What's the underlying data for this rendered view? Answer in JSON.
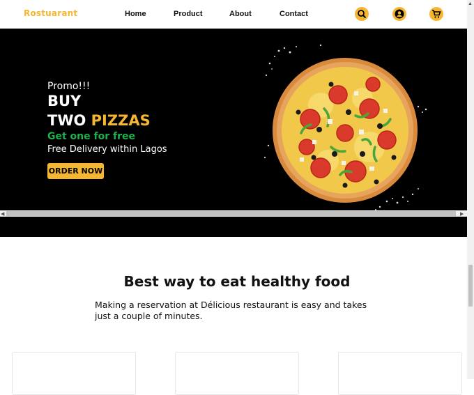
{
  "nav": {
    "logo": "Rostuarant",
    "links": [
      "Home",
      "Product",
      "About",
      "Contact"
    ],
    "icons": [
      "search-icon",
      "user-icon",
      "cart-icon"
    ],
    "accent": "#f5b731"
  },
  "hero": {
    "promo": "Promo!!!",
    "line1": "BUY",
    "line2_a": "TWO",
    "line2_b": "PIZZAS",
    "subline": "Get one for free",
    "delivery": "Free Delivery within Lagos",
    "cta": "ORDER NOW",
    "colors": {
      "background": "#000000",
      "accent": "#f5b731",
      "green": "#1bb14b"
    }
  },
  "section": {
    "title": "Best way to eat healthy food",
    "description": "Making a reservation at Délicious restaurant is easy and takes just a couple of minutes."
  }
}
